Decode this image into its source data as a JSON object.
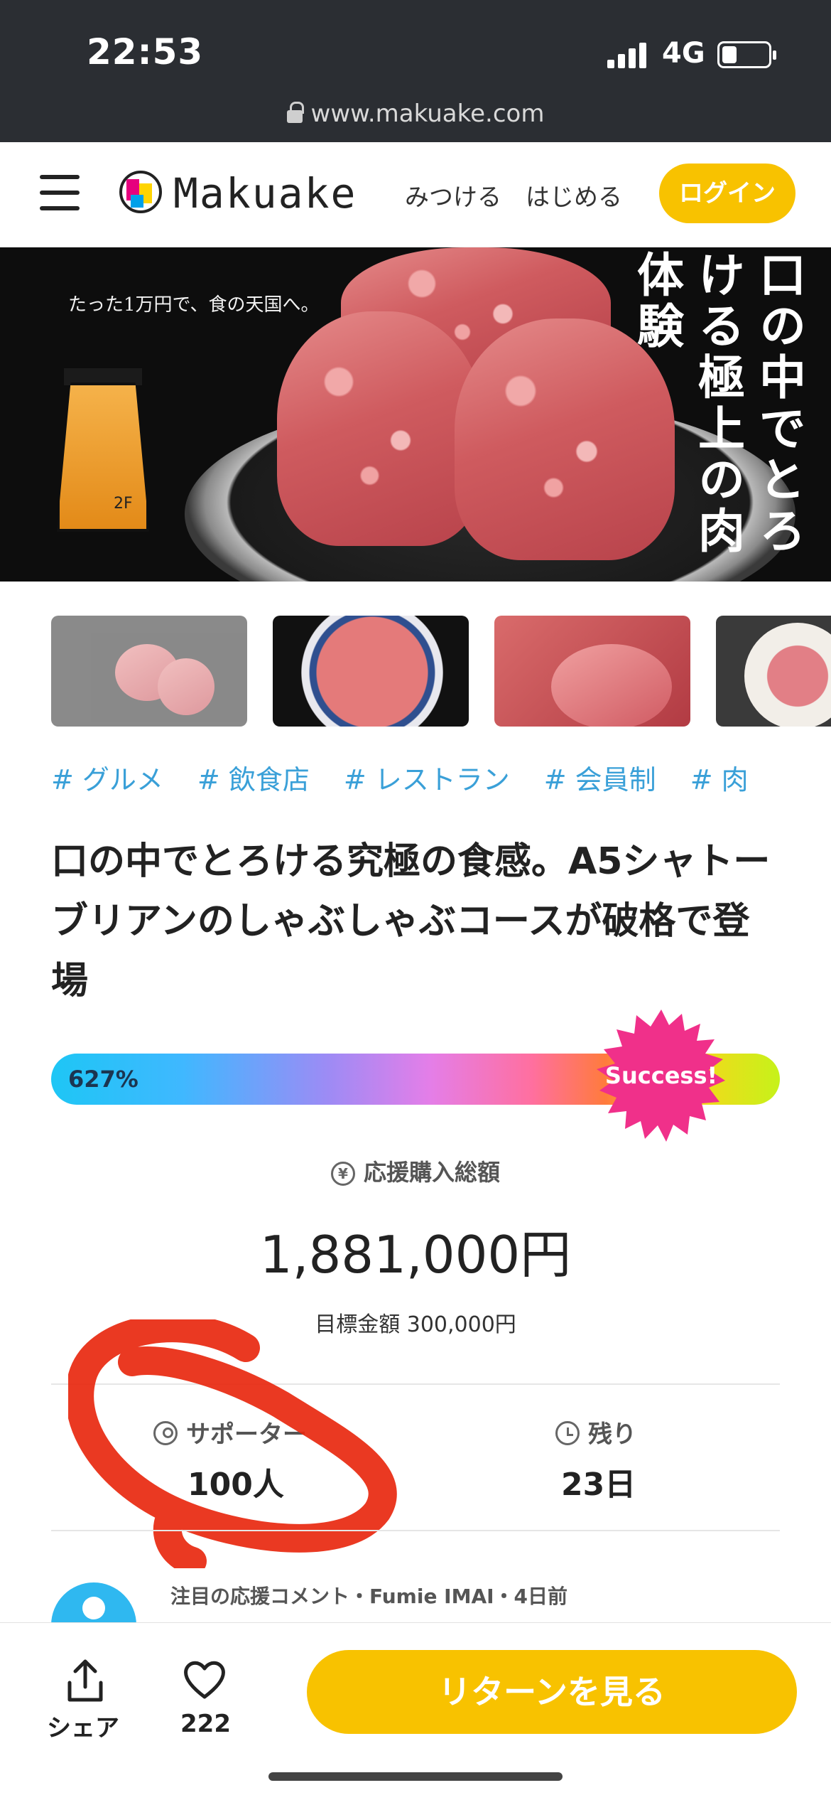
{
  "status_bar": {
    "time": "22:53",
    "network": "4G",
    "url": "www.makuake.com"
  },
  "header": {
    "logo_text": "Makuake",
    "nav": [
      "みつける",
      "はじめる"
    ],
    "login_label": "ログイン"
  },
  "hero": {
    "subtitle": "たった1万円で、食の天国へ。",
    "title": "口の中でとろける極上の肉体験",
    "lantern_text": "2F"
  },
  "tags": [
    "# グルメ",
    "# 飲食店",
    "# レストラン",
    "# 会員制",
    "# 肉"
  ],
  "project_title": "口の中でとろける究極の食感。A5シャトーブリアンのしゃぶしゃぶコースが破格で登場",
  "progress": {
    "percent_label": "627%",
    "badge": "Success!",
    "percent_value": 627
  },
  "funding": {
    "label": "応援購入総額",
    "amount": "1,881,000円",
    "goal": "目標金額 300,000円"
  },
  "stats": {
    "supporters_label": "サポーター",
    "supporters_value": "100人",
    "remaining_label": "残り",
    "remaining_value": "23日"
  },
  "comment": {
    "meta": "注目の応援コメント・Fumie IMAI・4日前"
  },
  "bottom_bar": {
    "share_label": "シェア",
    "likes": "222",
    "cta_label": "リターンを見る"
  },
  "colors": {
    "accent": "#f8c200",
    "tag": "#3aa0d8",
    "success_badge": "#f0308a",
    "annotation": "#e8280f"
  },
  "icons": [
    "lock-icon",
    "menu-icon",
    "yen-icon",
    "person-icon",
    "clock-icon",
    "share-icon",
    "heart-icon"
  ]
}
